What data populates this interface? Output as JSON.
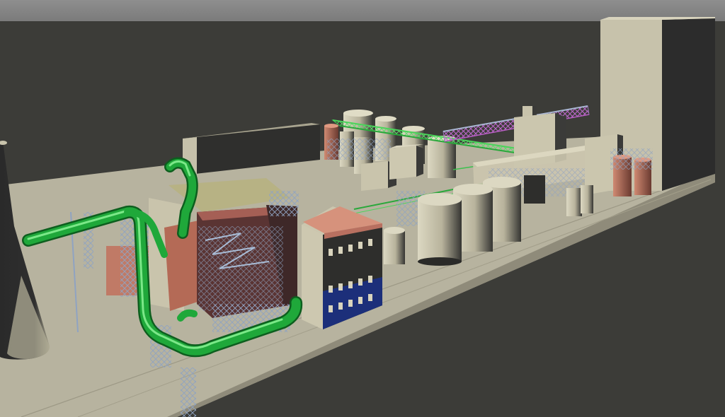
{
  "scene": {
    "colors": {
      "sky_top": "#8e8e8e",
      "sky_bottom": "#777777",
      "ground": "#3c3c38",
      "slab": "#b8b4a0",
      "slab_edge": "#8f8b7a",
      "wall_light": "#c9c4ac",
      "wall_shadow": "#3a3a3a",
      "tank": "#d0ccb5",
      "tank_dark": "#2e2e2c",
      "pipe_green": "#1fa83a",
      "pipe_green_light": "#6ee27f",
      "steel_blue": "#7f97b8",
      "rust": "#b86a55",
      "rust_dark": "#5a3432",
      "office_blue": "#1c2f7a",
      "magenta": "#b75cb5"
    },
    "objects": [
      "chimney-stack",
      "tall-silo-building",
      "boiler-house",
      "office-building",
      "storage-tanks",
      "pipe-rack",
      "warehouse-block"
    ]
  }
}
